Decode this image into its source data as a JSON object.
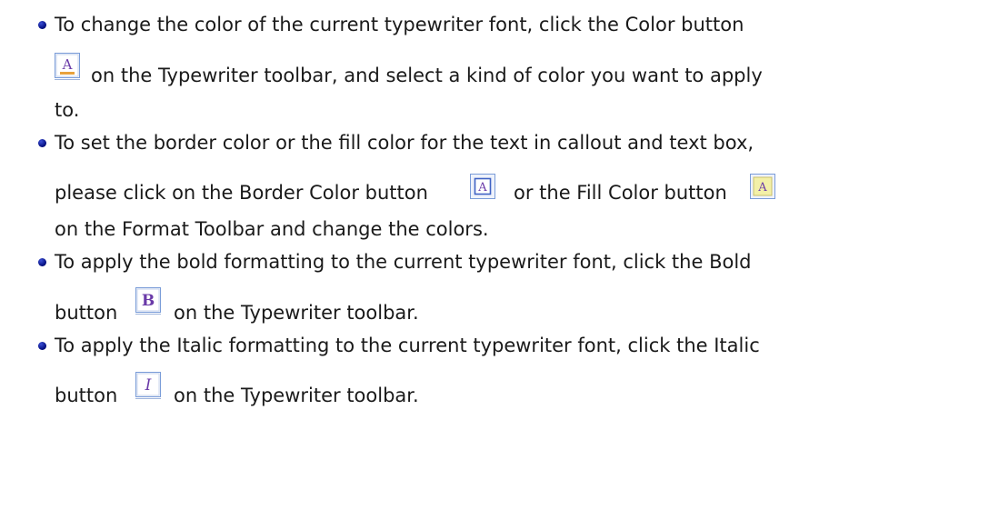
{
  "items": [
    {
      "lines": [
        "To change the color of the current typewriter font, click the Color button",
        "on the Typewriter toolbar, and select a kind of color you want to apply",
        "to."
      ],
      "icons": [
        {
          "name": "font-color-icon",
          "glyph": "A"
        }
      ]
    },
    {
      "lines": [
        "To set the border color or the fill color for the text in callout and text box,",
        "please click on the Border Color button",
        "or the Fill Color button",
        "on the Format Toolbar and change the colors."
      ],
      "icons": [
        {
          "name": "border-color-icon",
          "glyph": "A"
        },
        {
          "name": "fill-color-icon",
          "glyph": "A"
        }
      ]
    },
    {
      "lines": [
        "To apply the bold formatting to the current typewriter font, click the Bold",
        "button",
        "on the Typewriter toolbar."
      ],
      "icons": [
        {
          "name": "bold-icon",
          "glyph": "B"
        }
      ]
    },
    {
      "lines": [
        "To apply the Italic formatting to the current typewriter font, click the Italic",
        "button",
        "on the Typewriter toolbar."
      ],
      "icons": [
        {
          "name": "italic-icon",
          "glyph": "I"
        }
      ]
    }
  ],
  "colors": {
    "text": "#1a1a1a",
    "bullet": "#000a7a",
    "icon_border": "#7a9cd8",
    "icon_glyph": "#6a3aa8",
    "fill_icon_bg": "#f3f0a8"
  }
}
